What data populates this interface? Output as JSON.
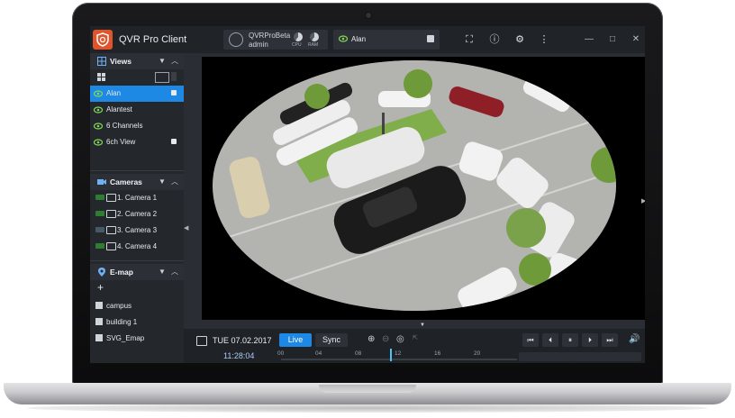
{
  "app": {
    "title": "QVR Pro Client",
    "user": {
      "name": "QVRProBeta",
      "role": "admin"
    },
    "meters": [
      "CPU",
      "RAM"
    ],
    "current_view": "Alan"
  },
  "sidebar": {
    "views": {
      "title": "Views",
      "items": [
        {
          "label": "Alan",
          "active": true,
          "locked": false
        },
        {
          "label": "Alantest",
          "active": false,
          "locked": false
        },
        {
          "label": "6 Channels",
          "active": false,
          "locked": false
        },
        {
          "label": "6ch View",
          "active": false,
          "locked": true
        }
      ]
    },
    "cameras": {
      "title": "Cameras",
      "items": [
        {
          "label": "1. Camera 1"
        },
        {
          "label": "2. Camera 2"
        },
        {
          "label": "3. Camera 3"
        },
        {
          "label": "4. Camera 4"
        }
      ]
    },
    "emap": {
      "title": "E-map",
      "add_label": "+",
      "items": [
        {
          "label": "campus"
        },
        {
          "label": "building 1"
        },
        {
          "label": "SVG_Emap"
        }
      ]
    }
  },
  "playback": {
    "date": "TUE 07.02.2017",
    "live_label": "Live",
    "sync_label": "Sync",
    "time": "11:28:04",
    "ticks": [
      "00",
      "04",
      "08",
      "12",
      "16",
      "20"
    ],
    "playhead_fraction": 0.46
  },
  "colors": {
    "accent": "#1e88e5",
    "logo": "#e1542b",
    "camera_badge": "#2e7d32",
    "background": "#2a2d33"
  }
}
